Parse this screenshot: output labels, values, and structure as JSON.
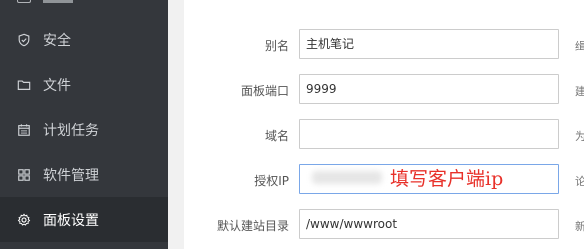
{
  "sidebar": {
    "items": [
      {
        "label": "安全",
        "icon": "shield-icon"
      },
      {
        "label": "文件",
        "icon": "folder-icon"
      },
      {
        "label": "计划任务",
        "icon": "calendar-icon"
      },
      {
        "label": "软件管理",
        "icon": "grid-icon"
      },
      {
        "label": "面板设置",
        "icon": "gear-icon",
        "active": true
      }
    ]
  },
  "form": {
    "alias": {
      "label": "别名",
      "value": "主机笔记"
    },
    "port": {
      "label": "面板端口",
      "value": "9999"
    },
    "domain": {
      "label": "域名",
      "value": ""
    },
    "auth_ip": {
      "label": "授权IP",
      "value": "",
      "note": "填写客户端ip"
    },
    "default_dir": {
      "label": "默认建站目录",
      "value": "/www/wwwroot"
    }
  },
  "edge_hints": [
    "缉",
    "建",
    "为",
    "论",
    "新"
  ],
  "colors": {
    "sidebar_bg": "#34373c",
    "sidebar_active": "#2a2d31",
    "note_red": "#e8312a",
    "focus_border": "#7aa7e8"
  }
}
